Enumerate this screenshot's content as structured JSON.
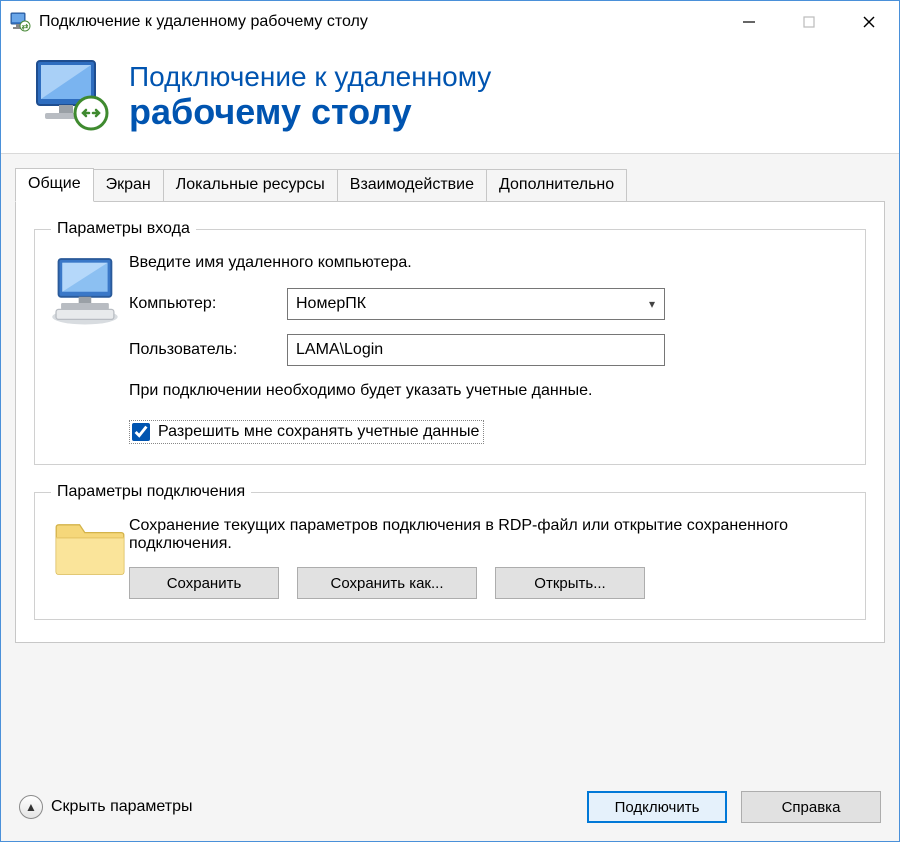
{
  "titlebar": {
    "title": "Подключение к удаленному рабочему столу"
  },
  "header": {
    "line1": "Подключение к удаленному",
    "line2": "рабочему столу"
  },
  "tabs": {
    "general": "Общие",
    "display": "Экран",
    "local_resources": "Локальные ресурсы",
    "experience": "Взаимодействие",
    "advanced": "Дополнительно"
  },
  "login_group": {
    "legend": "Параметры входа",
    "prompt": "Введите имя удаленного компьютера.",
    "computer_label": "Компьютер:",
    "computer_value": "НомерПК",
    "user_label": "Пользователь:",
    "user_value": "LAMA\\Login",
    "note": "При подключении необходимо будет указать учетные данные.",
    "allow_save_label": "Разрешить мне сохранять учетные данные"
  },
  "conn_group": {
    "legend": "Параметры подключения",
    "descr": "Сохранение текущих параметров подключения в RDP-файл или открытие сохраненного подключения.",
    "save": "Сохранить",
    "save_as": "Сохранить как...",
    "open": "Открыть..."
  },
  "footer": {
    "collapse": "Скрыть параметры",
    "connect": "Подключить",
    "help": "Справка"
  }
}
